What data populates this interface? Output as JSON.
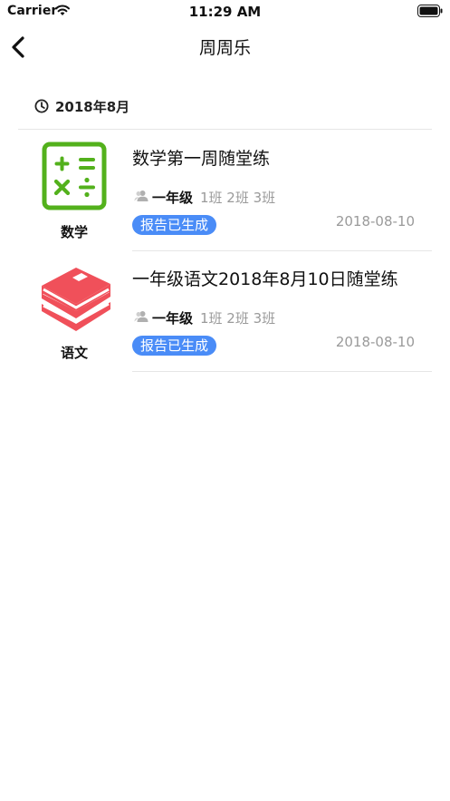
{
  "status_bar": {
    "carrier": "Carrier",
    "time": "11:29 AM"
  },
  "nav": {
    "title": "周周乐"
  },
  "section": {
    "label": "2018年8月"
  },
  "items": [
    {
      "subject": "数学",
      "icon": "calculator-icon",
      "title": "数学第一周随堂练",
      "grade": "一年级",
      "classes": "1班 2班 3班",
      "status": "报告已生成",
      "date": "2018-08-10"
    },
    {
      "subject": "语文",
      "icon": "books-icon",
      "title": "一年级语文2018年8月10日随堂练",
      "grade": "一年级",
      "classes": "1班 2班 3班",
      "status": "报告已生成",
      "date": "2018-08-10"
    }
  ],
  "colors": {
    "math_green": "#53b11c",
    "chinese_red": "#f0505a",
    "badge_blue": "#4a8cf7"
  }
}
